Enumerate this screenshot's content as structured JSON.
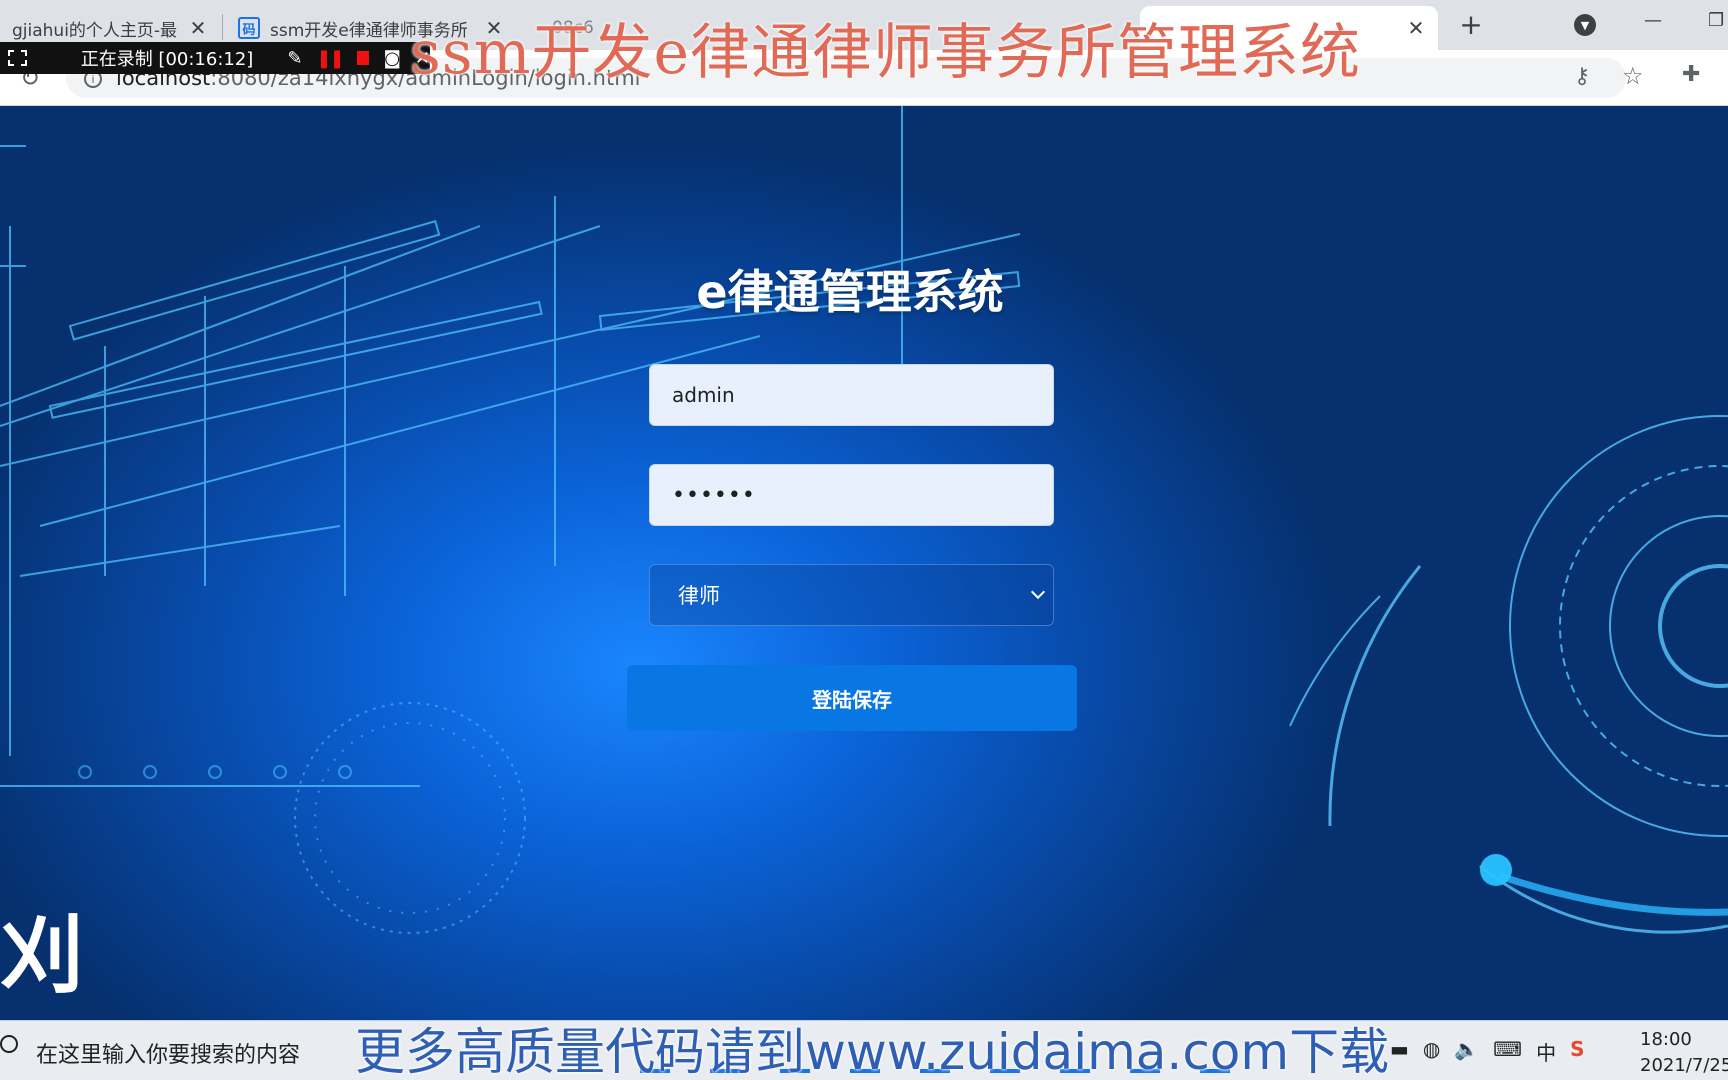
{
  "browser": {
    "tabs": [
      {
        "label": "gjiahui的个人主页-最",
        "active": false
      },
      {
        "label": "ssm开发e律通律师事务所",
        "active": false
      },
      {
        "label": "08c6",
        "active": false
      },
      {
        "label": "",
        "active": true
      }
    ],
    "url_host": "localhost",
    "url_path": ":8080/za14ixhygx/adminLogin/login.html"
  },
  "recording": {
    "text": "正在录制 [00:16:12]"
  },
  "login": {
    "title": "e律通管理系统",
    "username_value": "admin",
    "password_value": "••••••",
    "role_selected": "律师",
    "submit_label": "登陆保存"
  },
  "background": {
    "corner_glyph": "刈"
  },
  "watermarks": {
    "top": "ssm开发e律通律师事务所管理系统",
    "bottom": "更多高质量代码请到www.zuidaima.com下载"
  },
  "taskbar": {
    "search_placeholder": "在这里输入你要搜索的内容",
    "ime_label": "中",
    "time": "18:00",
    "date": "2021/7/25"
  },
  "colors": {
    "accent": "#0877e3",
    "page_bg": "#0b63d8",
    "watermark_top": "#e06a55",
    "watermark_bottom": "#2f5fb5"
  }
}
